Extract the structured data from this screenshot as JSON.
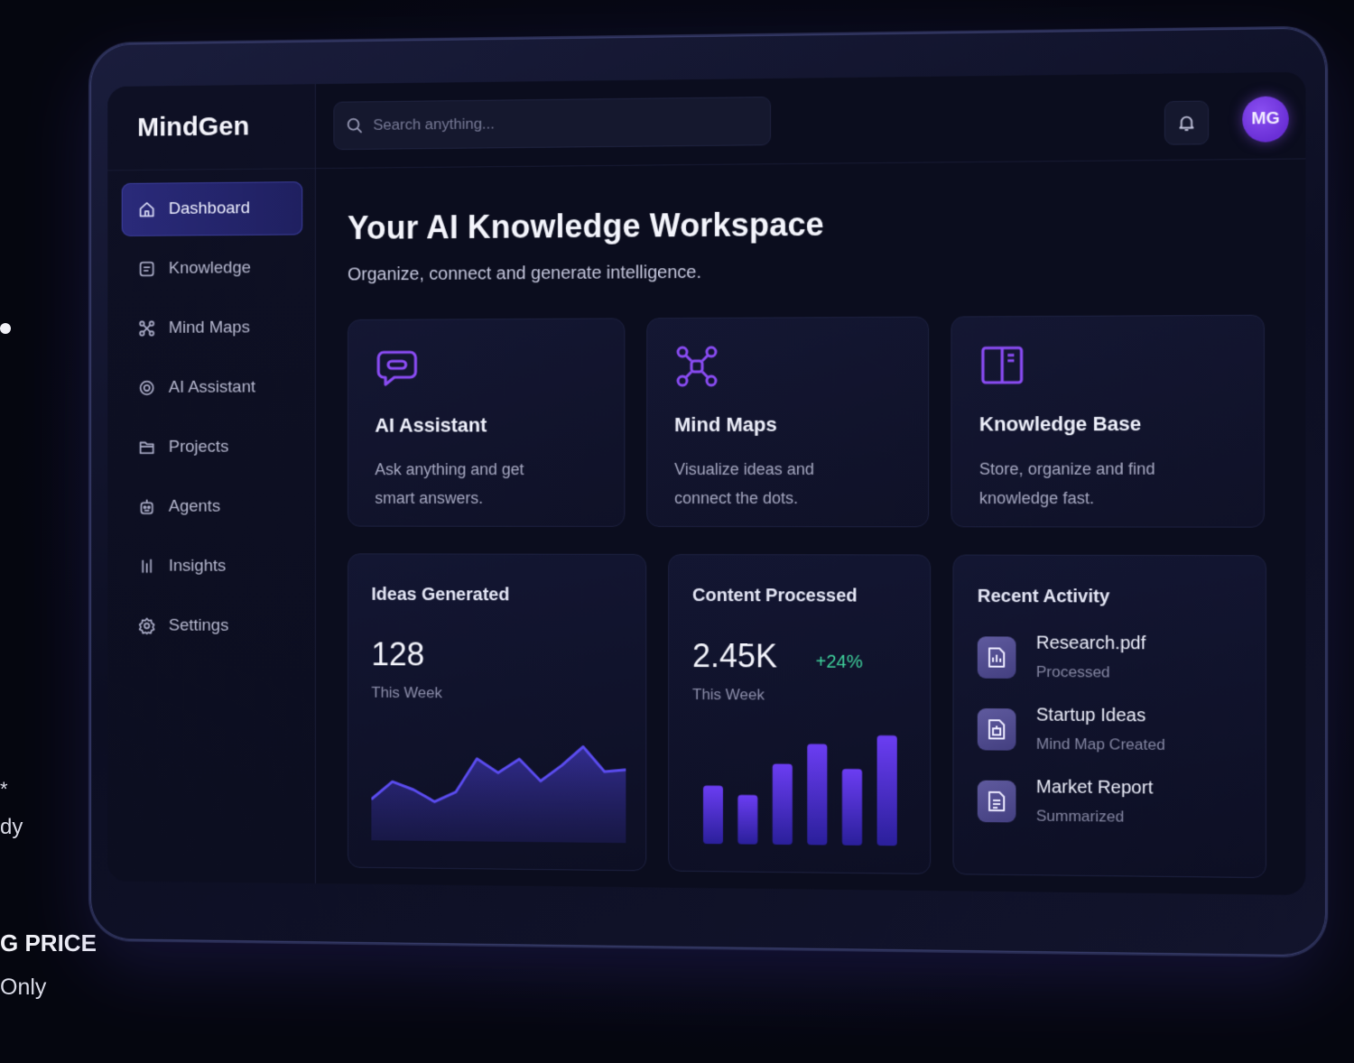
{
  "background": {
    "star": "*",
    "partial_text_1": "dy",
    "partial_text_2": "G PRICE",
    "partial_text_3": "Only"
  },
  "app": {
    "name": "MindGen"
  },
  "search": {
    "placeholder": "Search anything..."
  },
  "user": {
    "initials": "MG",
    "avatar_color": "#7c3aed"
  },
  "sidebar": {
    "items": [
      {
        "label": "Dashboard",
        "icon": "home-icon",
        "active": true
      },
      {
        "label": "Knowledge",
        "icon": "document-icon"
      },
      {
        "label": "Mind Maps",
        "icon": "mindmap-icon"
      },
      {
        "label": "AI Assistant",
        "icon": "target-icon"
      },
      {
        "label": "Projects",
        "icon": "folder-icon"
      },
      {
        "label": "Agents",
        "icon": "robot-icon"
      },
      {
        "label": "Insights",
        "icon": "chart-icon"
      },
      {
        "label": "Settings",
        "icon": "gear-icon"
      }
    ]
  },
  "header": {
    "title": "Your AI Knowledge Workspace",
    "subtitle": "Organize, connect and generate intelligence."
  },
  "features": [
    {
      "title": "AI Assistant",
      "description": "Ask anything and get smart answers.",
      "icon": "chat-icon"
    },
    {
      "title": "Mind Maps",
      "description": "Visualize ideas and connect the dots.",
      "icon": "nodes-icon"
    },
    {
      "title": "Knowledge Base",
      "description": "Store, organize and find knowledge fast.",
      "icon": "book-icon"
    }
  ],
  "stats": {
    "ideas": {
      "title": "Ideas Generated",
      "value": "128",
      "period": "This Week"
    },
    "content": {
      "title": "Content Processed",
      "value": "2.45K",
      "delta": "+24%",
      "period": "This Week"
    }
  },
  "recent_activity": {
    "title": "Recent Activity",
    "items": [
      {
        "name": "Research.pdf",
        "status": "Processed",
        "icon": "pdf-file-icon"
      },
      {
        "name": "Startup Ideas",
        "status": "Mind Map Created",
        "icon": "map-file-icon"
      },
      {
        "name": "Market Report",
        "status": "Summarized",
        "icon": "report-file-icon"
      }
    ]
  },
  "colors": {
    "accent": "#7c3aed",
    "positive": "#3fd29c",
    "chart_line": "#5b4cf0"
  },
  "chart_data": [
    {
      "type": "area",
      "x": [
        1,
        2,
        3,
        4,
        5,
        6,
        7,
        8,
        9,
        10,
        11,
        12,
        13
      ],
      "values": [
        40,
        58,
        50,
        38,
        48,
        82,
        68,
        82,
        60,
        76,
        95,
        70,
        72
      ],
      "ylim": [
        0,
        100
      ]
    },
    {
      "type": "bar",
      "values": [
        52,
        44,
        72,
        90,
        68,
        98
      ],
      "ylim": [
        0,
        100
      ]
    }
  ]
}
